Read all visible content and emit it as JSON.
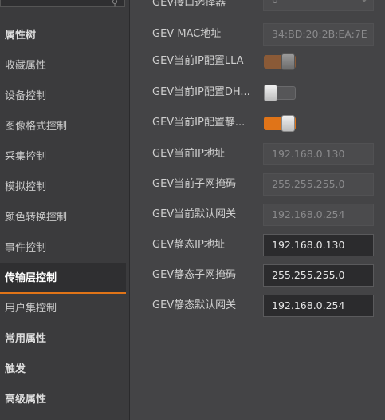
{
  "sidebar": {
    "items": [
      {
        "label": "属性树",
        "style": "bold"
      },
      {
        "label": "收藏属性",
        "style": "normal"
      },
      {
        "label": "设备控制",
        "style": "normal"
      },
      {
        "label": "图像格式控制",
        "style": "normal"
      },
      {
        "label": "采集控制",
        "style": "normal"
      },
      {
        "label": "模拟控制",
        "style": "normal"
      },
      {
        "label": "颜色转换控制",
        "style": "normal"
      },
      {
        "label": "事件控制",
        "style": "normal"
      },
      {
        "label": "传输层控制",
        "style": "active"
      },
      {
        "label": "用户集控制",
        "style": "normal"
      },
      {
        "label": "常用属性",
        "style": "bold"
      },
      {
        "label": "触发",
        "style": "bold"
      },
      {
        "label": "高级属性",
        "style": "bold"
      }
    ]
  },
  "properties": {
    "interface_selector": {
      "label": "GEV接口选择器",
      "value": "0"
    },
    "mac_address": {
      "label": "GEV MAC地址",
      "value": "34:BD:20:2B:EA:7E"
    },
    "ip_config_lla": {
      "label": "GEV当前IP配置LLA",
      "state": "on-disabled"
    },
    "ip_config_dhcp": {
      "label": "GEV当前IP配置DH...",
      "state": "off"
    },
    "ip_config_static": {
      "label": "GEV当前IP配置静...",
      "state": "on"
    },
    "current_ip": {
      "label": "GEV当前IP地址",
      "value": "192.168.0.130"
    },
    "current_subnet": {
      "label": "GEV当前子网掩码",
      "value": "255.255.255.0"
    },
    "current_gateway": {
      "label": "GEV当前默认网关",
      "value": "192.168.0.254"
    },
    "static_ip": {
      "label": "GEV静态IP地址",
      "value": "192.168.0.130"
    },
    "static_subnet": {
      "label": "GEV静态子网掩码",
      "value": "255.255.255.0"
    },
    "static_gateway": {
      "label": "GEV静态默认网关",
      "value": "192.168.0.254"
    }
  },
  "colors": {
    "accent": "#e07418",
    "panel": "#444446",
    "sidebar": "#3b3b3d"
  }
}
